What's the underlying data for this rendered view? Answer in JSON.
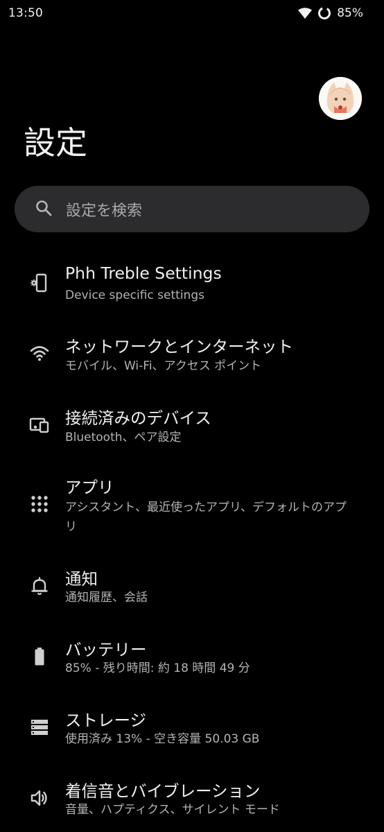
{
  "status_bar": {
    "time": "13:50",
    "battery_percent": "85%",
    "icons": [
      "wifi-icon",
      "battery-ring-icon"
    ]
  },
  "header": {
    "title": "設定",
    "avatar": "profile-avatar"
  },
  "search": {
    "placeholder": "設定を検索",
    "icon": "search-icon"
  },
  "settings": {
    "items": [
      {
        "title": "Phh Treble Settings",
        "subtitle": "Device specific settings",
        "icon": "phone-gear-icon"
      },
      {
        "title": "ネットワークとインターネット",
        "subtitle": "モバイル、Wi-Fi、アクセス ポイント",
        "icon": "wifi-icon"
      },
      {
        "title": "接続済みのデバイス",
        "subtitle": "Bluetooth、ペア設定",
        "icon": "connected-devices-icon"
      },
      {
        "title": "アプリ",
        "subtitle": "アシスタント、最近使ったアプリ、デフォルトのアプリ",
        "icon": "apps-grid-icon"
      },
      {
        "title": "通知",
        "subtitle": "通知履歴、会話",
        "icon": "bell-icon"
      },
      {
        "title": "バッテリー",
        "subtitle": "85% - 残り時間: 約 18 時間 49 分",
        "icon": "battery-icon"
      },
      {
        "title": "ストレージ",
        "subtitle": "使用済み 13% - 空き容量 50.03 GB",
        "icon": "storage-icon"
      },
      {
        "title": "着信音とバイブレーション",
        "subtitle": "音量、ハプティクス、サイレント モード",
        "icon": "speaker-icon"
      }
    ]
  }
}
